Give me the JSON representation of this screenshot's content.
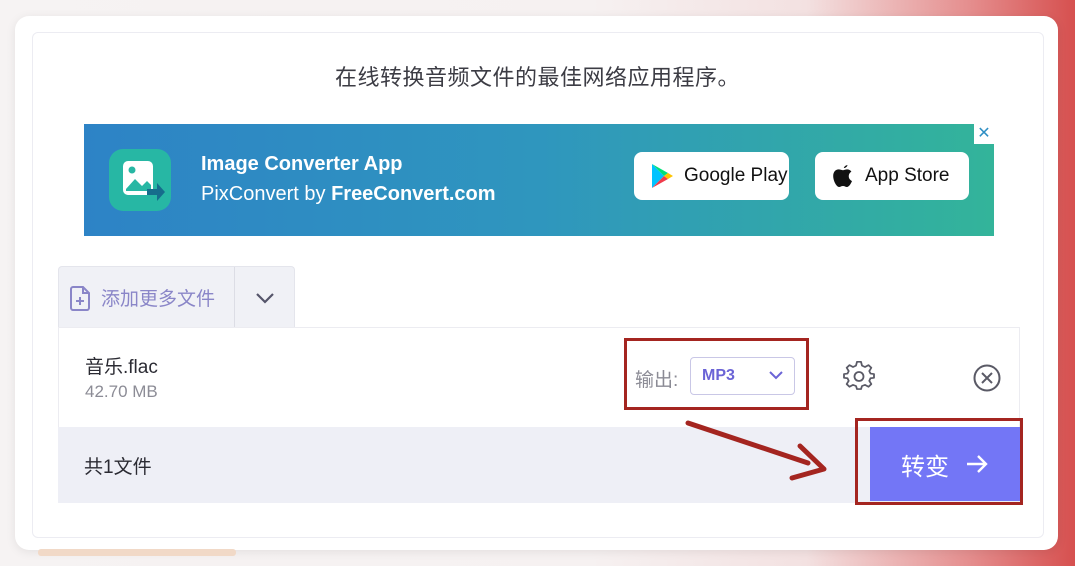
{
  "page": {
    "tagline": "在线转换音频文件的最佳网络应用程序。"
  },
  "ad": {
    "title": "Image Converter App",
    "subtitle_prefix": "PixConvert by ",
    "subtitle_brand": "FreeConvert.com",
    "close_label": "✕",
    "google_play_label": "Google Play",
    "app_store_label": "App Store",
    "colors": {
      "start": "#2d83c6",
      "end": "#33b49a"
    }
  },
  "uploader": {
    "add_files_label": "添加更多文件",
    "file": {
      "name": "音乐.flac",
      "size": "42.70 MB",
      "output_label": "输出:",
      "output_format": "MP3"
    },
    "summary": "共1文件",
    "convert_label": "转变"
  },
  "colors": {
    "accent": "#7376f6",
    "highlight_border": "#a42520"
  }
}
